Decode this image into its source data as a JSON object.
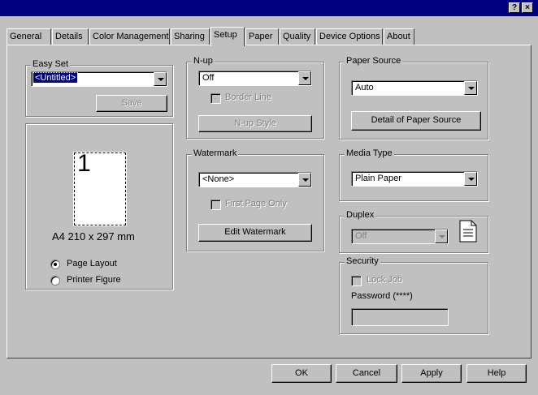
{
  "window": {
    "help_btn": "?",
    "close_btn": "×"
  },
  "tabs": [
    "General",
    "Details",
    "Color Management",
    "Sharing",
    "Setup",
    "Paper",
    "Quality",
    "Device Options",
    "About"
  ],
  "easy_set": {
    "legend": "Easy Set",
    "value": "<Untitled>",
    "save": "Save"
  },
  "preview": {
    "page_number": "1",
    "size_label": "A4 210 x 297 mm",
    "radio_page_layout": "Page Layout",
    "radio_printer_figure": "Printer Figure",
    "selected": "Page Layout"
  },
  "nup": {
    "legend": "N-up",
    "value": "Off",
    "border_line": "Border Line",
    "style_button": "N-up Style"
  },
  "watermark": {
    "legend": "Watermark",
    "value": "<None>",
    "first_page_only": "First Page Only",
    "edit_button": "Edit Watermark"
  },
  "paper_source": {
    "legend": "Paper Source",
    "value": "Auto",
    "detail_button": "Detail of Paper Source"
  },
  "media_type": {
    "legend": "Media Type",
    "value": "Plain Paper"
  },
  "duplex": {
    "legend": "Duplex",
    "value": "Off"
  },
  "security": {
    "legend": "Security",
    "lock_job": "Lock Job",
    "password_label": "Password (****)"
  },
  "footer": {
    "ok": "OK",
    "cancel": "Cancel",
    "apply": "Apply",
    "help": "Help"
  },
  "colors": {
    "titlebar": "#000080",
    "face": "#c0c0c0"
  }
}
